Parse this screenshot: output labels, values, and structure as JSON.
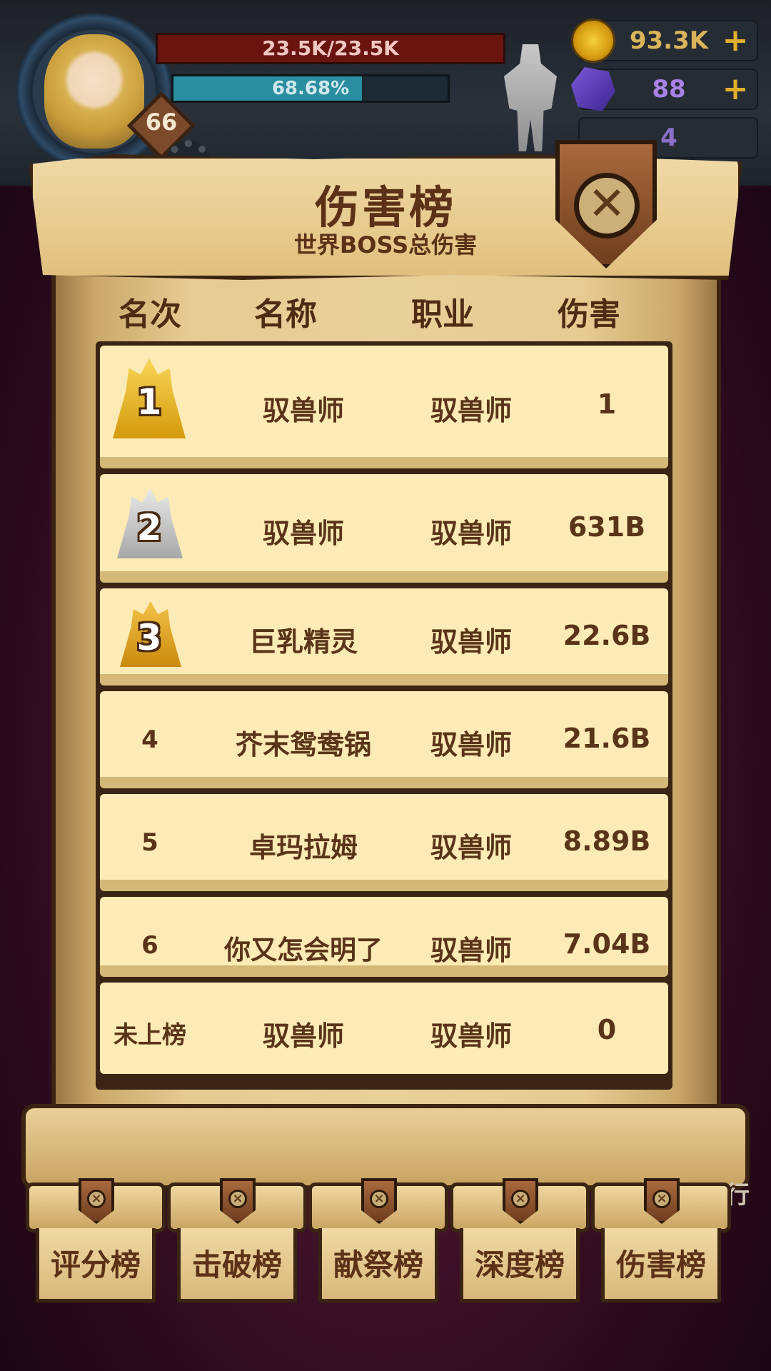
{
  "hud": {
    "level": "66",
    "hp_text": "23.5K/23.5K",
    "xp_percent_text": "68.68%",
    "xp_fraction": 0.6868,
    "gold": "93.3K",
    "gems": "88",
    "keys": "4",
    "plus": "+"
  },
  "panel": {
    "title": "伤害榜",
    "subtitle": "世界BOSS总伤害",
    "close_glyph": "✕"
  },
  "columns": {
    "rank": "名次",
    "name": "名称",
    "class": "职业",
    "damage": "伤害"
  },
  "rows": [
    {
      "rank": "1",
      "name": "驭兽师",
      "class": "驭兽师",
      "damage": "1"
    },
    {
      "rank": "2",
      "name": "驭兽师",
      "class": "驭兽师",
      "damage": "631B"
    },
    {
      "rank": "3",
      "name": "巨乳精灵",
      "class": "驭兽师",
      "damage": "22.6B"
    },
    {
      "rank": "4",
      "name": "芥末鸳鸯锅",
      "class": "驭兽师",
      "damage": "21.6B"
    },
    {
      "rank": "5",
      "name": "卓玛拉姆",
      "class": "驭兽师",
      "damage": "8.89B"
    },
    {
      "rank": "6",
      "name": "你又怎会明了",
      "class": "驭兽师",
      "damage": "7.04B"
    }
  ],
  "self_row": {
    "rank": "未上榜",
    "name": "驭兽师",
    "class": "驭兽师",
    "damage": "0"
  },
  "tabs": [
    {
      "label": "评分榜"
    },
    {
      "label": "击破榜"
    },
    {
      "label": "献祭榜"
    },
    {
      "label": "深度榜"
    },
    {
      "label": "伤害榜"
    }
  ],
  "side_text": "行",
  "colors": {
    "parchment": "#fcebb6",
    "ink": "#5a3418",
    "gold_crown": "#f3c83a",
    "silver_crown": "#c9c9c9",
    "bronze_crown": "#e3a720",
    "hp_bar": "#6a1410",
    "xp_bar": "#2a8da0"
  }
}
